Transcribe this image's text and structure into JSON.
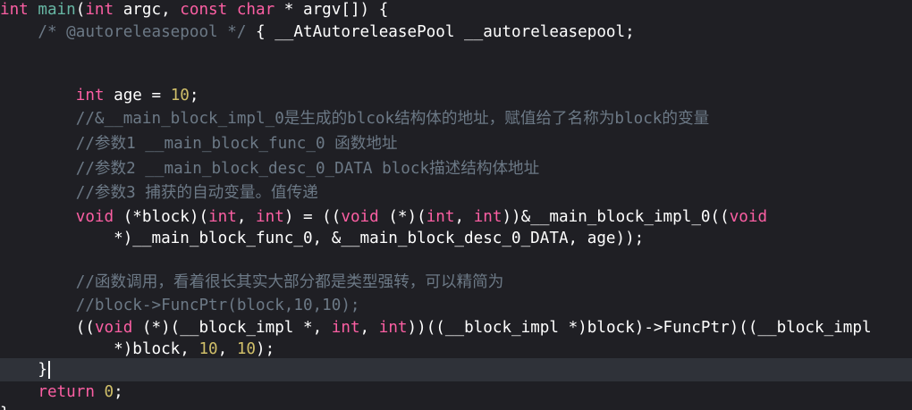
{
  "colors": {
    "background": "#1f1f24",
    "current_line": "#2f3239",
    "keyword": "#fc5fa3",
    "function": "#67b7a4",
    "comment": "#6c7986",
    "number": "#d0bf69",
    "plain": "#ffffff"
  },
  "code": {
    "l1": {
      "t1": "int",
      "t2": " ",
      "t3": "main",
      "t4": "(",
      "t5": "int",
      "t6": " argc, ",
      "t7": "const",
      "t8": " ",
      "t9": "char",
      "t10": " * argv[]) {"
    },
    "l2": {
      "t1": "    ",
      "t2": "/* @autoreleasepool */",
      "t3": " { __AtAutoreleasePool __autoreleasepool;"
    },
    "l5": {
      "t1": "        ",
      "t2": "int",
      "t3": " age = ",
      "t4": "10",
      "t5": ";"
    },
    "l6": {
      "t1": "        ",
      "t2": "//&__main_block_impl_0是生成的blcok结构体的地址，赋值给了名称为block的变量"
    },
    "l7": {
      "t1": "        ",
      "t2": "//参数1 __main_block_func_0 函数地址"
    },
    "l8": {
      "t1": "        ",
      "t2": "//参数2 __main_block_desc_0_DATA block描述结构体地址"
    },
    "l9": {
      "t1": "        ",
      "t2": "//参数3 捕获的自动变量。值传递"
    },
    "l10": {
      "t1": "        ",
      "t2": "void",
      "t3": " (*block)(",
      "t4": "int",
      "t5": ", ",
      "t6": "int",
      "t7": ") = ((",
      "t8": "void",
      "t9": " (*)(",
      "t10": "int",
      "t11": ", ",
      "t12": "int",
      "t13": "))&__main_block_impl_0((",
      "t14": "void"
    },
    "l11": {
      "t1": "            *)__main_block_func_0, &__main_block_desc_0_DATA, age));"
    },
    "l13": {
      "t1": "        ",
      "t2": "//函数调用，看着很长其实大部分都是类型强转，可以精简为"
    },
    "l14": {
      "t1": "        ",
      "t2": "//block->FuncPtr(block,10,10);"
    },
    "l15": {
      "t1": "        ((",
      "t2": "void",
      "t3": " (*)(__block_impl *, ",
      "t4": "int",
      "t5": ", ",
      "t6": "int",
      "t7": "))((__block_impl *)block)->FuncPtr)((__block_impl"
    },
    "l16": {
      "t1": "            *)block, ",
      "t2": "10",
      "t3": ", ",
      "t4": "10",
      "t5": ");"
    },
    "l17": {
      "t1": "    }"
    },
    "l18": {
      "t1": "    ",
      "t2": "return",
      "t3": " ",
      "t4": "0",
      "t5": ";"
    },
    "l19": {
      "t1": "}"
    }
  }
}
